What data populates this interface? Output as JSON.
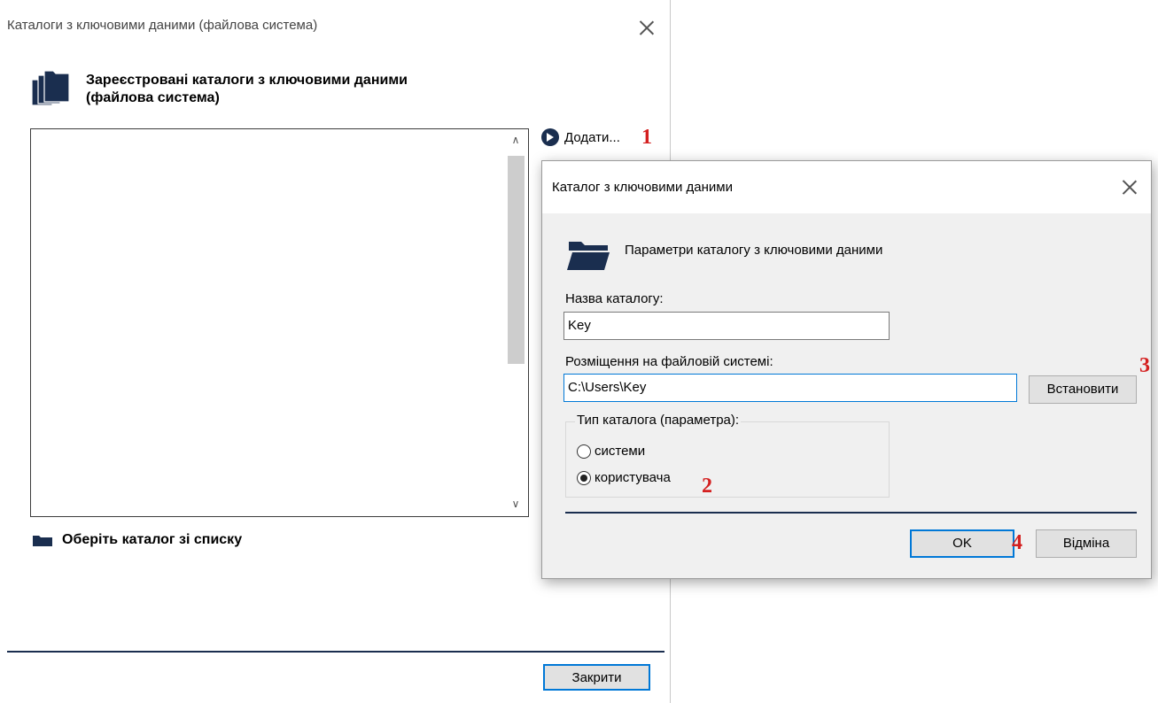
{
  "main_dialog": {
    "title": "Каталоги з ключовими даними (файлова система)",
    "header": "Зареєстровані каталоги з ключовими даними (файлова система)",
    "header_line1": "Зареєстровані каталоги з ключовими даними",
    "header_line2": "(файлова система)",
    "add_label": "Додати...",
    "choose_label": "Оберіть каталог зі списку",
    "close_button": "Закрити"
  },
  "sub_dialog": {
    "title": "Каталог з ключовими даними",
    "header": "Параметри каталогу з ключовими даними",
    "name_label": "Назва каталогу:",
    "name_value": "Key",
    "location_label": "Розміщення на файловій системі:",
    "location_value": "C:\\Users\\Key",
    "set_button": "Встановити",
    "type_group_label": "Тип каталога (параметра):",
    "radio_system": "системи",
    "radio_user": "користувача",
    "selected_type": "користувача",
    "ok_button": "OK",
    "cancel_button": "Відміна"
  },
  "annotations": [
    "1",
    "2",
    "3",
    "4"
  ],
  "colors": {
    "icon_navy": "#1a2e4f",
    "focus_blue": "#0078d7",
    "annotation_red": "#d42020"
  }
}
